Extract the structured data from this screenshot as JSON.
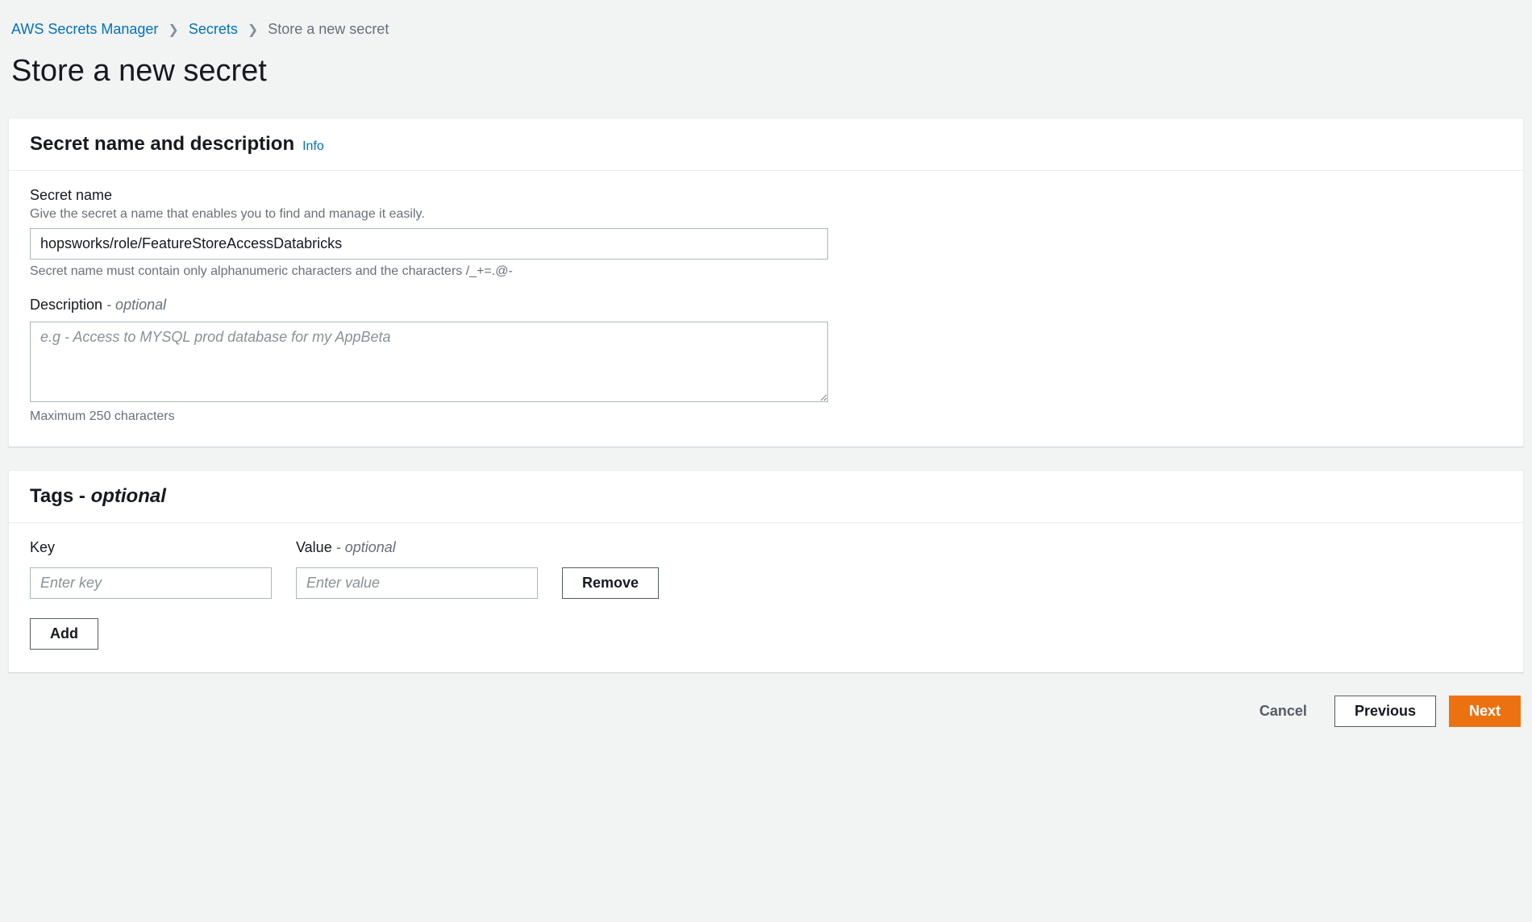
{
  "breadcrumb": {
    "items": [
      {
        "label": "AWS Secrets Manager",
        "link": true
      },
      {
        "label": "Secrets",
        "link": true
      },
      {
        "label": "Store a new secret",
        "link": false
      }
    ]
  },
  "page": {
    "title": "Store a new secret"
  },
  "secret_panel": {
    "heading": "Secret name and description",
    "info_link": "Info",
    "name": {
      "label": "Secret name",
      "helper": "Give the secret a name that enables you to find and manage it easily.",
      "value": "hopsworks/role/FeatureStoreAccessDatabricks",
      "constraint": "Secret name must contain only alphanumeric characters and the characters /_+=.@-"
    },
    "description": {
      "label": "Description",
      "optional_suffix": "- optional",
      "placeholder": "e.g - Access to MYSQL prod database for my AppBeta",
      "value": "",
      "constraint": "Maximum 250 characters"
    }
  },
  "tags_panel": {
    "heading": "Tags -",
    "optional_suffix": "optional",
    "key": {
      "label": "Key",
      "placeholder": "Enter key",
      "value": ""
    },
    "value": {
      "label": "Value",
      "optional_suffix": "- optional",
      "placeholder": "Enter value",
      "value": ""
    },
    "remove_label": "Remove",
    "add_label": "Add"
  },
  "footer": {
    "cancel": "Cancel",
    "previous": "Previous",
    "next": "Next"
  }
}
